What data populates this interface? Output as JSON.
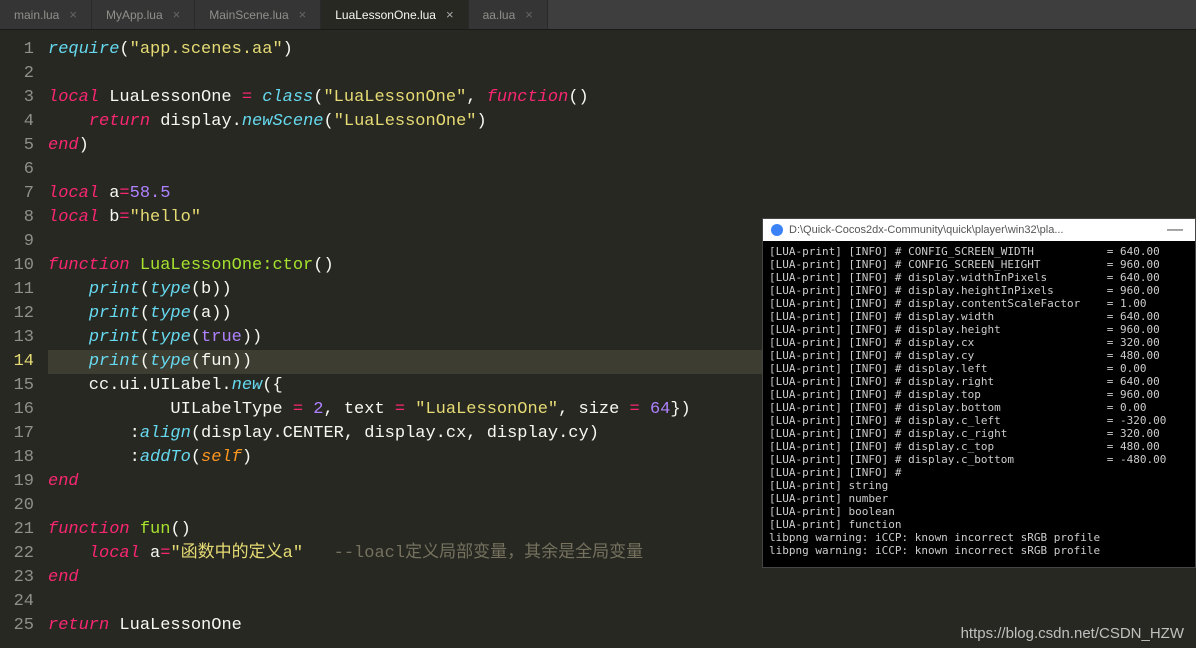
{
  "tabs": [
    {
      "label": "main.lua",
      "active": false
    },
    {
      "label": "MyApp.lua",
      "active": false
    },
    {
      "label": "MainScene.lua",
      "active": false
    },
    {
      "label": "LuaLessonOne.lua",
      "active": true
    },
    {
      "label": "aa.lua",
      "active": false
    }
  ],
  "code": {
    "lines": [
      [
        {
          "t": "require",
          "c": "fn"
        },
        {
          "t": "(",
          "c": "punct"
        },
        {
          "t": "\"app.scenes.aa\"",
          "c": "str"
        },
        {
          "t": ")",
          "c": "punct"
        }
      ],
      [],
      [
        {
          "t": "local ",
          "c": "kw"
        },
        {
          "t": "LuaLessonOne ",
          "c": "norm"
        },
        {
          "t": "= ",
          "c": "op"
        },
        {
          "t": "class",
          "c": "fn"
        },
        {
          "t": "(",
          "c": "punct"
        },
        {
          "t": "\"LuaLessonOne\"",
          "c": "str"
        },
        {
          "t": ", ",
          "c": "punct"
        },
        {
          "t": "function",
          "c": "kw"
        },
        {
          "t": "()",
          "c": "punct"
        }
      ],
      [
        {
          "t": "    ",
          "c": "norm"
        },
        {
          "t": "return ",
          "c": "kw"
        },
        {
          "t": "display.",
          "c": "norm"
        },
        {
          "t": "newScene",
          "c": "fn"
        },
        {
          "t": "(",
          "c": "punct"
        },
        {
          "t": "\"LuaLessonOne\"",
          "c": "str"
        },
        {
          "t": ")",
          "c": "punct"
        }
      ],
      [
        {
          "t": "end",
          "c": "kw"
        },
        {
          "t": ")",
          "c": "punct"
        }
      ],
      [],
      [
        {
          "t": "local ",
          "c": "kw"
        },
        {
          "t": "a",
          "c": "norm"
        },
        {
          "t": "=",
          "c": "op"
        },
        {
          "t": "58.5",
          "c": "num"
        }
      ],
      [
        {
          "t": "local ",
          "c": "kw"
        },
        {
          "t": "b",
          "c": "norm"
        },
        {
          "t": "=",
          "c": "op"
        },
        {
          "t": "\"hello\"",
          "c": "str"
        }
      ],
      [],
      [
        {
          "t": "function ",
          "c": "kw"
        },
        {
          "t": "LuaLessonOne:ctor",
          "c": "id"
        },
        {
          "t": "()",
          "c": "punct"
        }
      ],
      [
        {
          "t": "    ",
          "c": "norm"
        },
        {
          "t": "print",
          "c": "fn"
        },
        {
          "t": "(",
          "c": "punct"
        },
        {
          "t": "type",
          "c": "fn"
        },
        {
          "t": "(b))",
          "c": "punct"
        }
      ],
      [
        {
          "t": "    ",
          "c": "norm"
        },
        {
          "t": "print",
          "c": "fn"
        },
        {
          "t": "(",
          "c": "punct"
        },
        {
          "t": "type",
          "c": "fn"
        },
        {
          "t": "(a))",
          "c": "punct"
        }
      ],
      [
        {
          "t": "    ",
          "c": "norm"
        },
        {
          "t": "print",
          "c": "fn"
        },
        {
          "t": "(",
          "c": "punct"
        },
        {
          "t": "type",
          "c": "fn"
        },
        {
          "t": "(",
          "c": "punct"
        },
        {
          "t": "true",
          "c": "const"
        },
        {
          "t": "))",
          "c": "punct"
        }
      ],
      [
        {
          "t": "    ",
          "c": "norm"
        },
        {
          "t": "print",
          "c": "fn"
        },
        {
          "t": "(",
          "c": "punct"
        },
        {
          "t": "type",
          "c": "fn"
        },
        {
          "t": "(fun))",
          "c": "punct"
        }
      ],
      [
        {
          "t": "    cc.ui.UILabel.",
          "c": "norm"
        },
        {
          "t": "new",
          "c": "fn"
        },
        {
          "t": "({",
          "c": "punct"
        }
      ],
      [
        {
          "t": "            UILabelType ",
          "c": "norm"
        },
        {
          "t": "= ",
          "c": "op"
        },
        {
          "t": "2",
          "c": "num"
        },
        {
          "t": ", text ",
          "c": "norm"
        },
        {
          "t": "= ",
          "c": "op"
        },
        {
          "t": "\"LuaLessonOne\"",
          "c": "str"
        },
        {
          "t": ", size ",
          "c": "norm"
        },
        {
          "t": "= ",
          "c": "op"
        },
        {
          "t": "64",
          "c": "num"
        },
        {
          "t": "})",
          "c": "punct"
        }
      ],
      [
        {
          "t": "        :",
          "c": "norm"
        },
        {
          "t": "align",
          "c": "fn"
        },
        {
          "t": "(display.CENTER, display.cx, display.cy)",
          "c": "punct"
        }
      ],
      [
        {
          "t": "        :",
          "c": "norm"
        },
        {
          "t": "addTo",
          "c": "fn"
        },
        {
          "t": "(",
          "c": "punct"
        },
        {
          "t": "self",
          "c": "param"
        },
        {
          "t": ")",
          "c": "punct"
        }
      ],
      [
        {
          "t": "end",
          "c": "kw"
        }
      ],
      [],
      [
        {
          "t": "function ",
          "c": "kw"
        },
        {
          "t": "fun",
          "c": "id"
        },
        {
          "t": "()",
          "c": "punct"
        }
      ],
      [
        {
          "t": "    ",
          "c": "norm"
        },
        {
          "t": "local ",
          "c": "kw"
        },
        {
          "t": "a",
          "c": "norm"
        },
        {
          "t": "=",
          "c": "op"
        },
        {
          "t": "\"函数中的定义a\"",
          "c": "str"
        },
        {
          "t": "   ",
          "c": "norm"
        },
        {
          "t": "--loacl定义局部变量，其余是全局变量",
          "c": "cmt"
        }
      ],
      [
        {
          "t": "end",
          "c": "kw"
        }
      ],
      [],
      [
        {
          "t": "return ",
          "c": "kw"
        },
        {
          "t": "LuaLessonOne",
          "c": "norm"
        }
      ]
    ],
    "currentLine": 14
  },
  "console": {
    "title": "D:\\Quick-Cocos2dx-Community\\quick\\player\\win32\\pla...",
    "rows": [
      {
        "tag": "[LUA-print]",
        "lvl": "[INFO]",
        "k": "# CONFIG_SCREEN_WIDTH",
        "v": "= 640.00"
      },
      {
        "tag": "[LUA-print]",
        "lvl": "[INFO]",
        "k": "# CONFIG_SCREEN_HEIGHT",
        "v": "= 960.00"
      },
      {
        "tag": "[LUA-print]",
        "lvl": "[INFO]",
        "k": "# display.widthInPixels",
        "v": "= 640.00"
      },
      {
        "tag": "[LUA-print]",
        "lvl": "[INFO]",
        "k": "# display.heightInPixels",
        "v": "= 960.00"
      },
      {
        "tag": "[LUA-print]",
        "lvl": "[INFO]",
        "k": "# display.contentScaleFactor",
        "v": "= 1.00"
      },
      {
        "tag": "[LUA-print]",
        "lvl": "[INFO]",
        "k": "# display.width",
        "v": "= 640.00"
      },
      {
        "tag": "[LUA-print]",
        "lvl": "[INFO]",
        "k": "# display.height",
        "v": "= 960.00"
      },
      {
        "tag": "[LUA-print]",
        "lvl": "[INFO]",
        "k": "# display.cx",
        "v": "= 320.00"
      },
      {
        "tag": "[LUA-print]",
        "lvl": "[INFO]",
        "k": "# display.cy",
        "v": "= 480.00"
      },
      {
        "tag": "[LUA-print]",
        "lvl": "[INFO]",
        "k": "# display.left",
        "v": "= 0.00"
      },
      {
        "tag": "[LUA-print]",
        "lvl": "[INFO]",
        "k": "# display.right",
        "v": "= 640.00"
      },
      {
        "tag": "[LUA-print]",
        "lvl": "[INFO]",
        "k": "# display.top",
        "v": "= 960.00"
      },
      {
        "tag": "[LUA-print]",
        "lvl": "[INFO]",
        "k": "# display.bottom",
        "v": "= 0.00"
      },
      {
        "tag": "[LUA-print]",
        "lvl": "[INFO]",
        "k": "# display.c_left",
        "v": "= -320.00"
      },
      {
        "tag": "[LUA-print]",
        "lvl": "[INFO]",
        "k": "# display.c_right",
        "v": "= 320.00"
      },
      {
        "tag": "[LUA-print]",
        "lvl": "[INFO]",
        "k": "# display.c_top",
        "v": "= 480.00"
      },
      {
        "tag": "[LUA-print]",
        "lvl": "[INFO]",
        "k": "# display.c_bottom",
        "v": "= -480.00"
      },
      {
        "tag": "[LUA-print]",
        "lvl": "[INFO]",
        "k": "#",
        "v": ""
      },
      {
        "tag": "[LUA-print]",
        "lvl": "",
        "k": "string",
        "v": ""
      },
      {
        "tag": "[LUA-print]",
        "lvl": "",
        "k": "number",
        "v": ""
      },
      {
        "tag": "[LUA-print]",
        "lvl": "",
        "k": "boolean",
        "v": ""
      },
      {
        "tag": "[LUA-print]",
        "lvl": "",
        "k": "function",
        "v": ""
      }
    ],
    "warnings": [
      "libpng warning: iCCP: known incorrect sRGB profile",
      "libpng warning: iCCP: known incorrect sRGB profile"
    ]
  },
  "watermark": "https://blog.csdn.net/CSDN_HZW"
}
